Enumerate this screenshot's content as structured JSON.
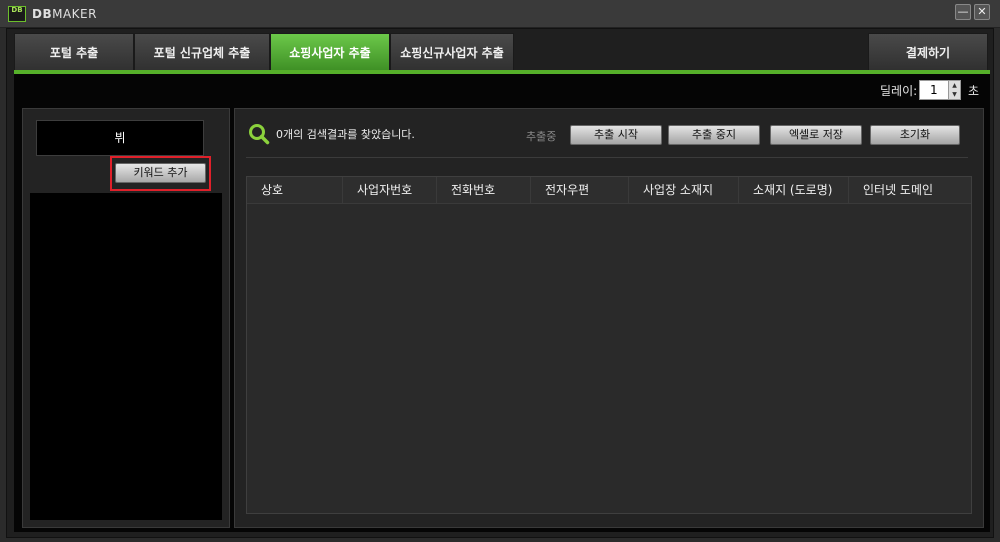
{
  "window": {
    "logo_text": "DB",
    "title_bold": "DB",
    "title_rest": "MAKER",
    "minimize_glyph": "—",
    "close_glyph": "✕"
  },
  "tabs": [
    {
      "label": "포털 추출",
      "active": false
    },
    {
      "label": "포털 신규업체 추출",
      "active": false
    },
    {
      "label": "쇼핑사업자 추출",
      "active": true
    },
    {
      "label": "쇼핑신규사업자 추출",
      "active": false
    }
  ],
  "payment_button": "결제하기",
  "delay": {
    "label": "딜레이:",
    "value": "1",
    "unit": "초"
  },
  "keyword": {
    "input_value": "뷔",
    "add_button": "키워드 추가"
  },
  "results": {
    "search_icon": "search-icon",
    "count_text": "0개의 검색결과를 찾았습니다.",
    "status": "추출중",
    "buttons": [
      "추출 시작",
      "추출 중지",
      "엑셀로 저장",
      "초기화"
    ]
  },
  "table": {
    "columns": [
      "상호",
      "사업자번호",
      "전화번호",
      "전자우편",
      "사업장 소재지",
      "소재지 (도로명)",
      "인터넷 도메인"
    ],
    "rows": []
  },
  "colors": {
    "accent_green": "#56b02a",
    "highlight_red": "#e0202a",
    "background": "#050505"
  }
}
